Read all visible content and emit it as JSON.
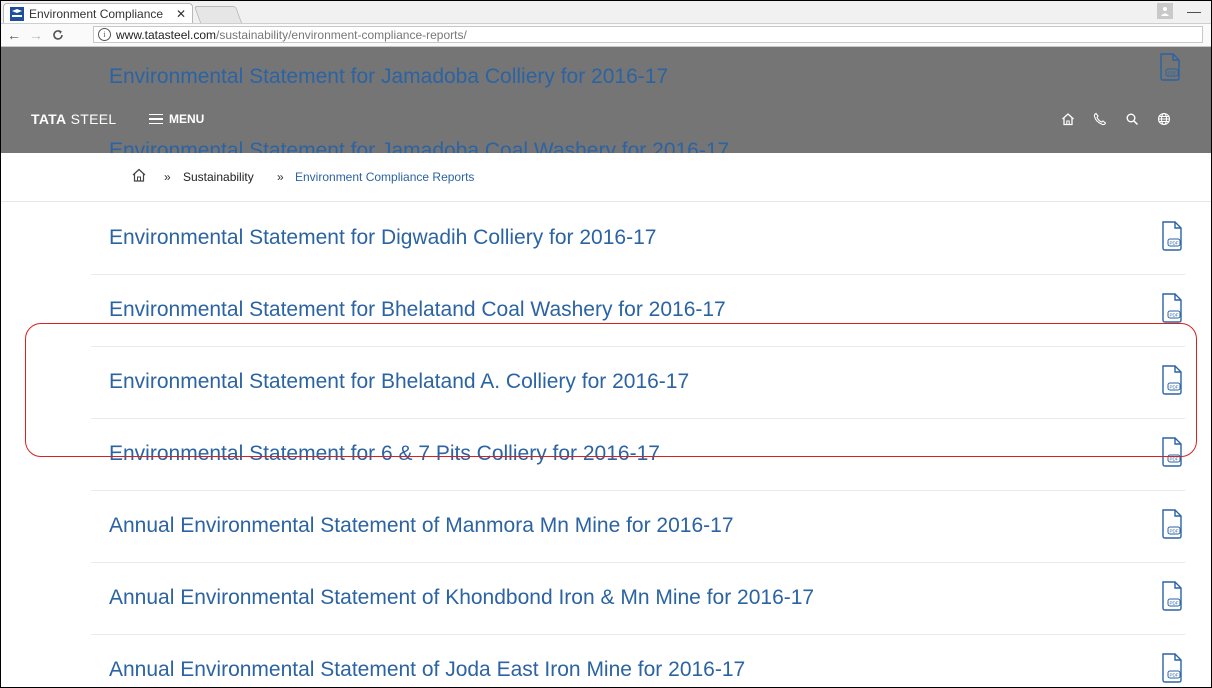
{
  "browser": {
    "tab_title": "Environment Compliance",
    "tab_close": "✕",
    "url_host": "www.tatasteel.com",
    "url_path": "/sustainability/environment-compliance-reports/"
  },
  "header": {
    "logo_bold": "TATA",
    "logo_rest": " STEEL",
    "menu_label": "MENU",
    "peek_top": "Environmental Statement for Jamadoba Colliery for 2016-17",
    "peek_bottom": "Environmental Statement for Jamadoba Coal Washery for 2016-17"
  },
  "breadcrumb": {
    "sep": "»",
    "sustainability": "Sustainability",
    "current": "Environment Compliance Reports"
  },
  "reports": [
    "Environmental Statement for Digwadih Colliery for 2016-17",
    "Environmental Statement for Bhelatand Coal Washery for 2016-17",
    "Environmental Statement for Bhelatand A. Colliery for 2016-17",
    "Environmental Statement for 6 & 7 Pits Colliery for 2016-17",
    "Annual Environmental Statement of Manmora Mn Mine for 2016-17",
    "Annual Environmental Statement of Khondbond Iron & Mn Mine for 2016-17",
    "Annual Environmental Statement of Joda East Iron Mine for 2016-17"
  ],
  "colors": {
    "link": "#2b63a3",
    "highlight": "#d92020",
    "header_overlay": "#6e6e6e"
  },
  "icons": {
    "pdf": "pdf-icon",
    "home": "home-icon",
    "phone": "phone-icon",
    "search": "search-icon",
    "globe": "globe-icon"
  }
}
